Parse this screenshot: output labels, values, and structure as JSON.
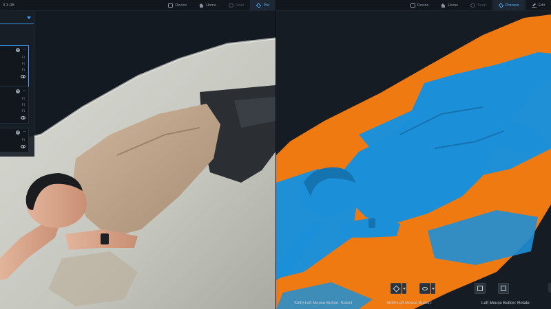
{
  "app": {
    "version": "3.3.46"
  },
  "left_nav": {
    "tabs": [
      {
        "label": "Device",
        "icon": "device-icon",
        "state": "normal"
      },
      {
        "label": "Home",
        "icon": "home-icon",
        "state": "normal"
      },
      {
        "label": "Scan",
        "icon": "scan-icon",
        "state": "dim"
      },
      {
        "label": "Pro",
        "icon": "process-icon",
        "state": "active"
      }
    ]
  },
  "right_nav": {
    "tabs": [
      {
        "label": "Device",
        "icon": "device-icon",
        "state": "normal"
      },
      {
        "label": "Home",
        "icon": "home-icon",
        "state": "normal"
      },
      {
        "label": "Scan",
        "icon": "scan-icon",
        "state": "dim"
      },
      {
        "label": "Process",
        "icon": "process-icon",
        "state": "active"
      },
      {
        "label": "Edit",
        "icon": "edit-icon",
        "state": "normal"
      }
    ]
  },
  "sidepanel": {
    "dropdown_icon": "chevron-down-icon",
    "cards": [
      {
        "selected": true,
        "icons": [
          "close-icon",
          "more-icon",
          "wave-icon",
          "wave-icon",
          "wave-icon",
          "eye-icon"
        ]
      },
      {
        "selected": false,
        "icons": [
          "close-icon",
          "more-icon",
          "wave-icon",
          "wave-icon",
          "wave-icon",
          "eye-icon"
        ]
      },
      {
        "selected": false,
        "icons": [
          "close-icon",
          "more-icon",
          "wave-icon",
          "eye-icon"
        ]
      }
    ]
  },
  "toolbar": {
    "hints": {
      "select": "Shift+Left Mouse Button:  Select",
      "pan": "Shift+Left Mouse Button:  ",
      "rotate": "Left Mouse Button:  Rotate"
    }
  },
  "colors": {
    "accent": "#3aa0ff",
    "model_blue": "#1f8fd6",
    "overlay_orange": "#f07a12"
  }
}
